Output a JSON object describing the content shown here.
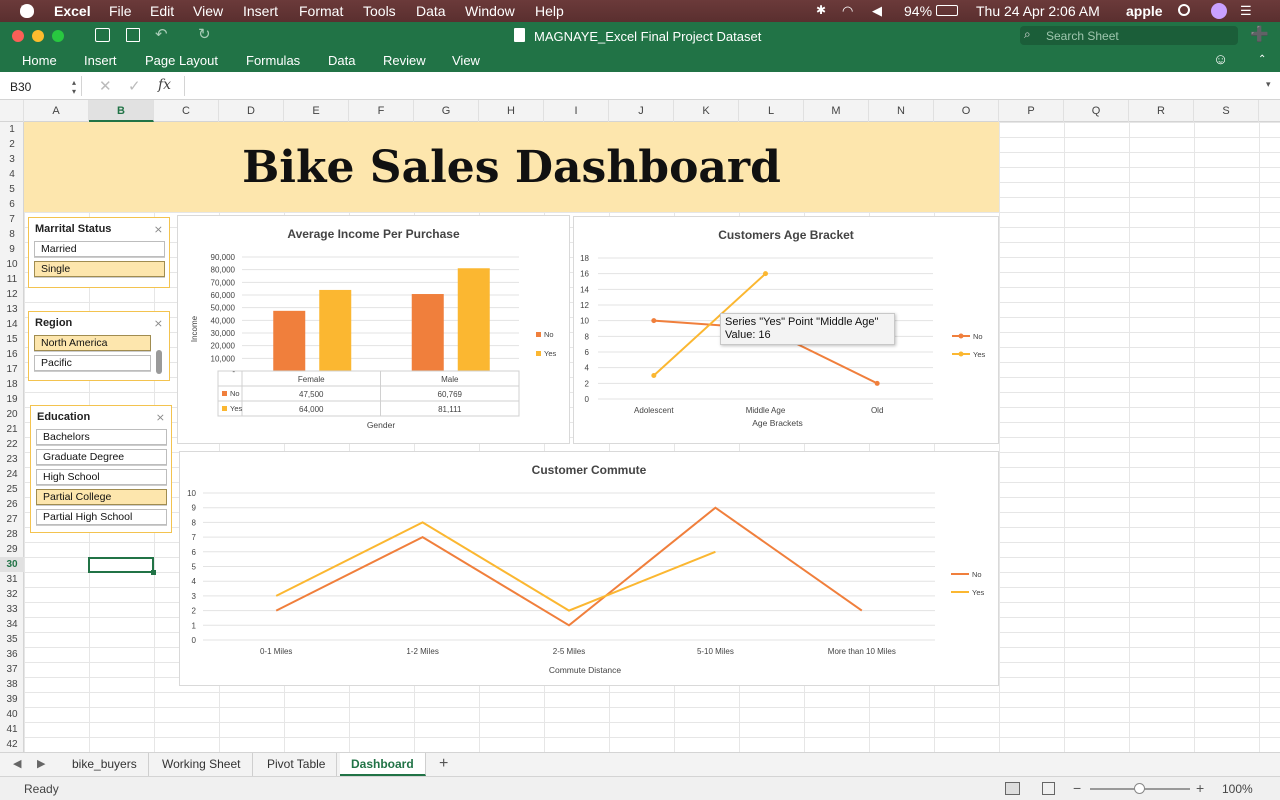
{
  "menubar": {
    "apple": "",
    "app": "Excel",
    "items": [
      "File",
      "Edit",
      "View",
      "Insert",
      "Format",
      "Tools",
      "Data",
      "Window",
      "Help"
    ],
    "battery": "94%",
    "clock": "Thu 24 Apr  2:06 AM",
    "user": "apple"
  },
  "title": {
    "doc": "MAGNAYE_Excel Final Project Dataset",
    "search_placeholder": "Search Sheet"
  },
  "ribbon": {
    "tabs": [
      "Home",
      "Insert",
      "Page Layout",
      "Formulas",
      "Data",
      "Review",
      "View"
    ]
  },
  "formula": {
    "namebox": "B30",
    "fx": "fx",
    "value": ""
  },
  "columns": [
    "A",
    "B",
    "C",
    "D",
    "E",
    "F",
    "G",
    "H",
    "I",
    "J",
    "K",
    "L",
    "M",
    "N",
    "O",
    "P",
    "Q",
    "R",
    "S"
  ],
  "rows": [
    "1",
    "2",
    "3",
    "4",
    "5",
    "6",
    "7",
    "8",
    "9",
    "10",
    "11",
    "12",
    "13",
    "14",
    "15",
    "16",
    "17",
    "18",
    "19",
    "20",
    "21",
    "22",
    "23",
    "24",
    "25",
    "26",
    "27",
    "28",
    "29",
    "30",
    "31",
    "32",
    "33",
    "34",
    "35",
    "36",
    "37",
    "38",
    "39",
    "40",
    "41",
    "42"
  ],
  "dashboard": {
    "title": "Bike Sales Dashboard"
  },
  "slicers": {
    "marital": {
      "title": "Marrital Status",
      "items": [
        "Married",
        "Single"
      ],
      "selected": [
        1
      ]
    },
    "region": {
      "title": "Region",
      "items": [
        "North America",
        "Pacific"
      ],
      "selected": [
        0
      ]
    },
    "education": {
      "title": "Education",
      "items": [
        "Bachelors",
        "Graduate Degree",
        "High School",
        "Partial College",
        "Partial High School"
      ],
      "selected": [
        3
      ]
    }
  },
  "tooltip": {
    "line1": "Series \"Yes\" Point \"Middle Age\"",
    "line2": "Value: 16"
  },
  "chart_data": [
    {
      "type": "bar",
      "title": "Average Income Per Purchase",
      "categories": [
        "Female",
        "Male"
      ],
      "series": [
        {
          "name": "No",
          "values": [
            47500,
            60769
          ],
          "color": "#f07f3c"
        },
        {
          "name": "Yes",
          "values": [
            64000,
            81111
          ],
          "color": "#fbb731"
        }
      ],
      "ylabel": "Income",
      "xlabel": "Gender",
      "ylim": [
        0,
        90000
      ],
      "yticks": [
        "-",
        "10,000",
        "20,000",
        "30,000",
        "40,000",
        "50,000",
        "60,000",
        "70,000",
        "80,000",
        "90,000"
      ],
      "table": {
        "rows": [
          {
            "label": "No",
            "cells": [
              "47,500",
              "60,769"
            ]
          },
          {
            "label": "Yes",
            "cells": [
              "64,000",
              "81,111"
            ]
          }
        ]
      },
      "legend": "right"
    },
    {
      "type": "line",
      "title": "Customers Age Bracket",
      "categories": [
        "Adolescent",
        "Middle Age",
        "Old"
      ],
      "series": [
        {
          "name": "No",
          "values": [
            10,
            9,
            2
          ],
          "color": "#f07f3c"
        },
        {
          "name": "Yes",
          "values": [
            3,
            16,
            null
          ],
          "color": "#fbb731"
        }
      ],
      "xlabel": "Age Brackets",
      "ylim": [
        0,
        18
      ],
      "yticks": [
        "0",
        "2",
        "4",
        "6",
        "8",
        "10",
        "12",
        "14",
        "16",
        "18"
      ],
      "legend": "right"
    },
    {
      "type": "line",
      "title": "Customer Commute",
      "categories": [
        "0-1 Miles",
        "1-2 Miles",
        "2-5 Miles",
        "5-10 Miles",
        "More than 10 Miles"
      ],
      "series": [
        {
          "name": "No",
          "values": [
            2,
            7,
            1,
            9,
            2
          ],
          "color": "#f07f3c"
        },
        {
          "name": "Yes",
          "values": [
            3,
            8,
            2,
            6,
            null
          ],
          "color": "#fbb731"
        }
      ],
      "xlabel": "Commute Distance",
      "ylim": [
        0,
        10
      ],
      "yticks": [
        "0",
        "1",
        "2",
        "3",
        "4",
        "5",
        "6",
        "7",
        "8",
        "9",
        "10"
      ],
      "legend": "right"
    }
  ],
  "sheets": {
    "tabs": [
      "bike_buyers",
      "Working Sheet",
      "Pivot Table",
      "Dashboard"
    ],
    "active": 3,
    "add": "+"
  },
  "status": {
    "text": "Ready",
    "zoom": "100%"
  }
}
